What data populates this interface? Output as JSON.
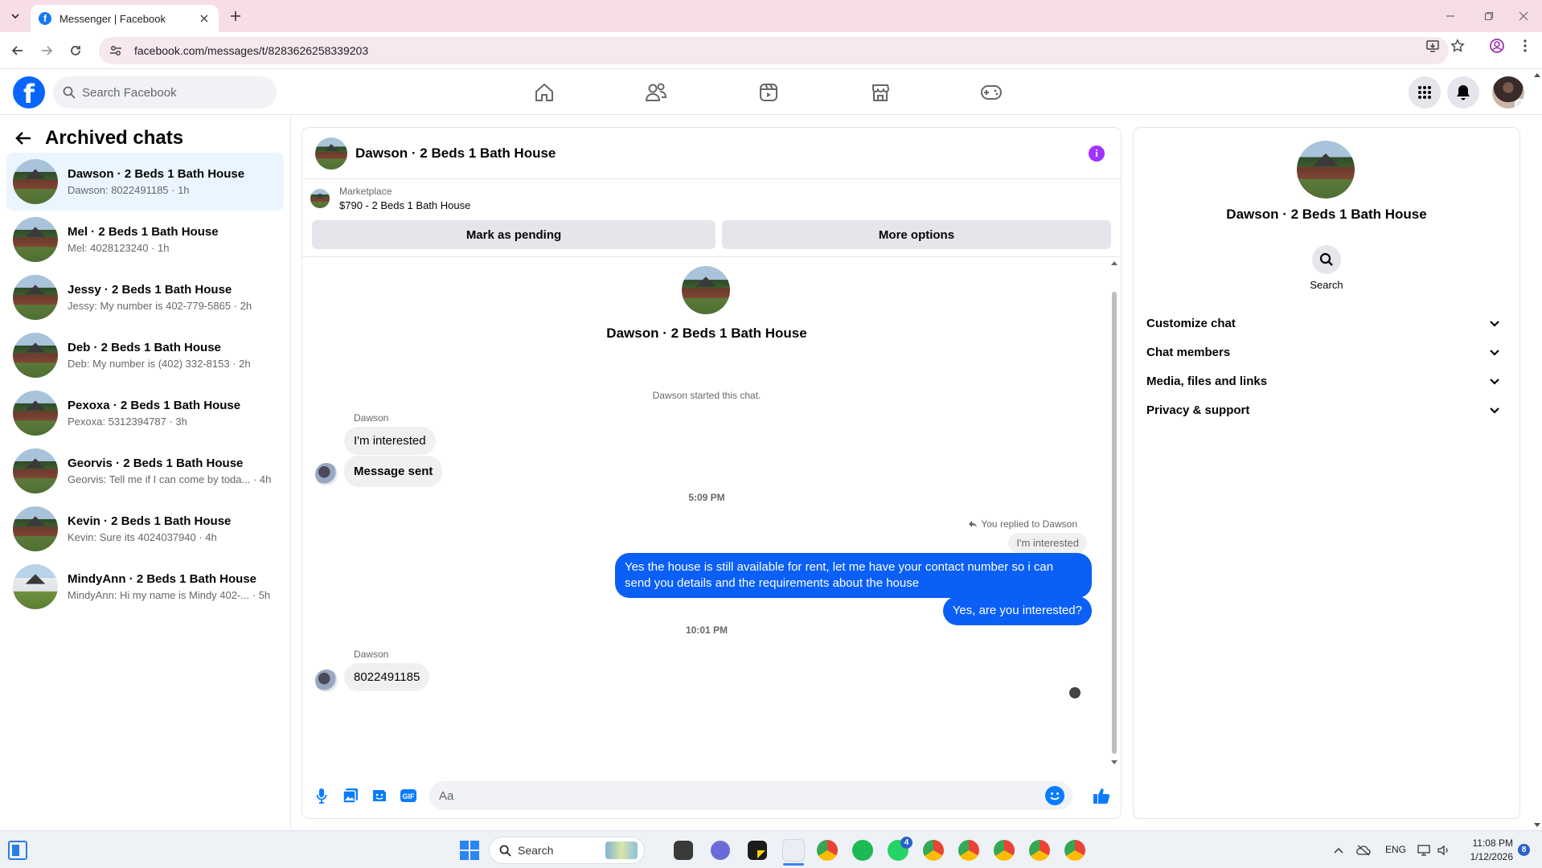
{
  "browser": {
    "tab_title": "Messenger | Facebook",
    "url": "facebook.com/messages/t/8283626258339203"
  },
  "fb_header": {
    "logo": "f",
    "search_placeholder": "Search Facebook"
  },
  "sidebar": {
    "title": "Archived chats",
    "conversations": [
      {
        "name": "Dawson · 2 Beds 1 Bath House",
        "preview": "Dawson: 8022491185 · 1h",
        "active": true
      },
      {
        "name": "Mel · 2 Beds 1 Bath House",
        "preview": "Mel: 4028123240 · 1h"
      },
      {
        "name": "Jessy · 2 Beds 1 Bath House",
        "preview": "Jessy: My number is 402-779-5865 · 2h"
      },
      {
        "name": "Deb · 2 Beds 1 Bath House",
        "preview": "Deb: My number is (402) 332-8153 · 2h"
      },
      {
        "name": "Pexoxa · 2 Beds 1 Bath House",
        "preview": "Pexoxa: 5312394787 · 3h"
      },
      {
        "name": "Georvis · 2 Beds 1 Bath House",
        "preview": "Georvis: Tell me if I can come by toda... · 4h"
      },
      {
        "name": "Kevin · 2 Beds 1 Bath House",
        "preview": "Kevin: Sure its 4024037940 · 4h"
      },
      {
        "name": "MindyAnn · 2 Beds 1 Bath House",
        "preview": "MindyAnn: Hi my name is Mindy 402-... · 5h"
      }
    ]
  },
  "chat": {
    "title": "Dawson · 2 Beds 1 Bath House",
    "info_glyph": "i",
    "marketplace_label": "Marketplace",
    "listing": "$790 - 2 Beds 1 Bath House",
    "mark_pending": "Mark as pending",
    "more_options": "More options",
    "intro_name": "Dawson · 2 Beds 1 Bath House",
    "started": "Dawson started this chat.",
    "sender1": "Dawson",
    "msg_interested": "I'm interested",
    "msg_sent": "Message sent",
    "time1": "5:09 PM",
    "replied_to": "You replied to Dawson",
    "quoted": "I'm interested",
    "reply1": "Yes the house is still available for rent, let me have your contact number so i can send you details and the requirements about the house",
    "reply2": "Yes, are you interested?",
    "time2": "10:01 PM",
    "sender2": "Dawson",
    "msg_number": "8022491185",
    "input_placeholder": "Aa"
  },
  "details": {
    "name": "Dawson · 2 Beds 1 Bath House",
    "search_label": "Search",
    "sections": [
      "Customize chat",
      "Chat members",
      "Media, files and links",
      "Privacy & support"
    ]
  },
  "taskbar": {
    "search_label": "Search",
    "lang": "ENG",
    "time": "11:08 PM",
    "date": "1/12/2026",
    "whatsapp_badge": "4",
    "notif_badge": "8"
  },
  "colors": {
    "accent_blue": "#0a5ff7",
    "fb_blue": "#0866ff",
    "active_row": "#ebf5ff",
    "info_purple": "#a033ff"
  }
}
